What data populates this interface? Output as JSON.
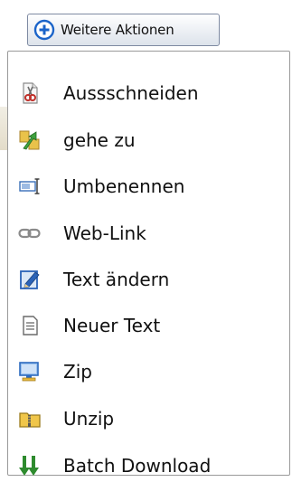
{
  "toolbar": {
    "more_actions_label": "Weitere Aktionen",
    "more_actions_icon": "plus-circle-icon"
  },
  "menu": {
    "items": [
      {
        "label": "Aussschneiden",
        "icon": "scissors-icon"
      },
      {
        "label": "gehe zu",
        "icon": "goto-arrow-icon"
      },
      {
        "label": "Umbenennen",
        "icon": "rename-icon"
      },
      {
        "label": "Web-Link",
        "icon": "link-icon"
      },
      {
        "label": "Text ändern",
        "icon": "edit-text-icon"
      },
      {
        "label": "Neuer Text",
        "icon": "new-text-icon"
      },
      {
        "label": "Zip",
        "icon": "zip-icon"
      },
      {
        "label": "Unzip",
        "icon": "unzip-icon"
      },
      {
        "label": "Batch Download",
        "icon": "download-arrows-icon"
      }
    ]
  },
  "colors": {
    "button_border": "#7e8aa2",
    "menu_border": "#9a9a9a",
    "icon_blue": "#1b64c9",
    "download_green": "#2e8b2e"
  }
}
